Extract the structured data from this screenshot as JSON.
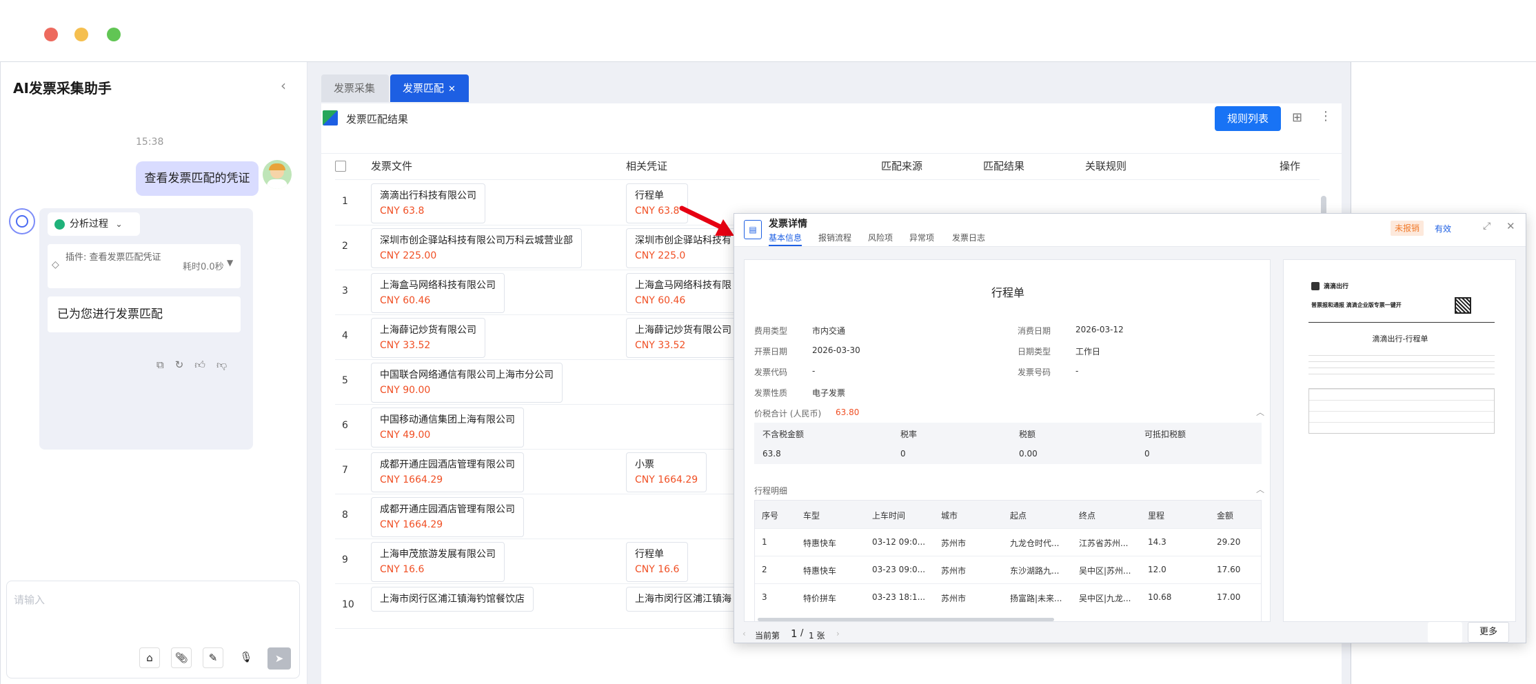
{
  "window": {
    "dots": [
      "#ed6a5e",
      "#f5bf4f",
      "#61c554"
    ]
  },
  "sidebar": {
    "title": "AI发票采集助手",
    "time": "15:38",
    "user_message": "查看发票匹配的凭证",
    "analysis_label": "分析过程",
    "plugin_label": "插件: 查看发票匹配凭证",
    "plugin_time": "耗时0.0秒",
    "reply": "已为您进行发票匹配",
    "input_placeholder": "请输入"
  },
  "tabs": [
    {
      "label": "发票采集",
      "active": false
    },
    {
      "label": "发票匹配",
      "active": true
    }
  ],
  "header": {
    "title": "发票匹配结果",
    "rules_button": "规则列表"
  },
  "table": {
    "columns": [
      "发票文件",
      "相关凭证",
      "匹配来源",
      "匹配结果",
      "关联规则",
      "操作"
    ],
    "rows": [
      {
        "no": "1",
        "invoice": "滴滴出行科技有限公司",
        "amount": "CNY 63.8",
        "voucher": "行程单",
        "voucher_amount": "CNY 63.8"
      },
      {
        "no": "2",
        "invoice": "深圳市创企驿站科技有限公司万科云城营业部",
        "amount": "CNY 225.00",
        "voucher": "深圳市创企驿站科技有",
        "voucher_amount": "CNY 225.0"
      },
      {
        "no": "3",
        "invoice": "上海盒马网络科技有限公司",
        "amount": "CNY 60.46",
        "voucher": "上海盒马网络科技有限",
        "voucher_amount": "CNY 60.46"
      },
      {
        "no": "4",
        "invoice": "上海薛记炒货有限公司",
        "amount": "CNY 33.52",
        "voucher": "上海薛记炒货有限公司",
        "voucher_amount": "CNY 33.52"
      },
      {
        "no": "5",
        "invoice": "中国联合网络通信有限公司上海市分公司",
        "amount": "CNY 90.00",
        "voucher": "",
        "voucher_amount": ""
      },
      {
        "no": "6",
        "invoice": "中国移动通信集团上海有限公司",
        "amount": "CNY 49.00",
        "voucher": "",
        "voucher_amount": ""
      },
      {
        "no": "7",
        "invoice": "成都开通庄园酒店管理有限公司",
        "amount": "CNY 1664.29",
        "voucher": "小票",
        "voucher_amount": "CNY 1664.29"
      },
      {
        "no": "8",
        "invoice": "成都开通庄园酒店管理有限公司",
        "amount": "CNY 1664.29",
        "voucher": "",
        "voucher_amount": ""
      },
      {
        "no": "9",
        "invoice": "上海申茂旅游发展有限公司",
        "amount": "CNY 16.6",
        "voucher": "行程单",
        "voucher_amount": "CNY 16.6"
      },
      {
        "no": "10",
        "invoice": "上海市闵行区浦江镇海钓馆餐饮店",
        "amount": "",
        "voucher": "上海市闵行区浦江镇海",
        "voucher_amount": ""
      }
    ]
  },
  "modal": {
    "title": "发票详情",
    "tabs": [
      "基本信息",
      "报销流程",
      "风险项",
      "异常项",
      "发票日志"
    ],
    "status_unreimbursed": "未报销",
    "status_valid": "有效",
    "doc_title": "行程单",
    "fields": [
      {
        "label": "费用类型",
        "value": "市内交通"
      },
      {
        "label": "消费日期",
        "value": "2026-03-12"
      },
      {
        "label": "开票日期",
        "value": "2026-03-30"
      },
      {
        "label": "日期类型",
        "value": "工作日"
      },
      {
        "label": "发票代码",
        "value": "-"
      },
      {
        "label": "发票号码",
        "value": "-"
      },
      {
        "label": "发票性质",
        "value": "电子发票"
      }
    ],
    "total_label": "价税合计 (人民币)",
    "total_value": "63.80",
    "tax": {
      "headers": [
        "不含税金额",
        "税率",
        "税额",
        "可抵扣税额"
      ],
      "values": [
        "63.8",
        "0",
        "0.00",
        "0"
      ]
    },
    "trip_label": "行程明细",
    "trip_headers": [
      "序号",
      "车型",
      "上车时间",
      "城市",
      "起点",
      "终点",
      "里程",
      "金额"
    ],
    "trips": [
      [
        "1",
        "特惠快车",
        "03-12 09:0...",
        "苏州市",
        "九龙仓时代...",
        "江苏省苏州...",
        "14.3",
        "29.20"
      ],
      [
        "2",
        "特惠快车",
        "03-23 09:0...",
        "苏州市",
        "东沙湖路九...",
        "吴中区|苏州...",
        "12.0",
        "17.60"
      ],
      [
        "3",
        "特价拼车",
        "03-23 18:1...",
        "苏州市",
        "扬富路|未来...",
        "吴中区|九龙...",
        "10.68",
        "17.00"
      ]
    ],
    "preview": {
      "brand": "滴滴出行",
      "slogan": "普票报和通报 滴滴企业版专票一键开",
      "title": "滴滴出行-行程单"
    },
    "pager": {
      "prefix": "当前第",
      "page": "1",
      "sep": "/",
      "total": "1 张"
    },
    "more_button": "更多"
  }
}
